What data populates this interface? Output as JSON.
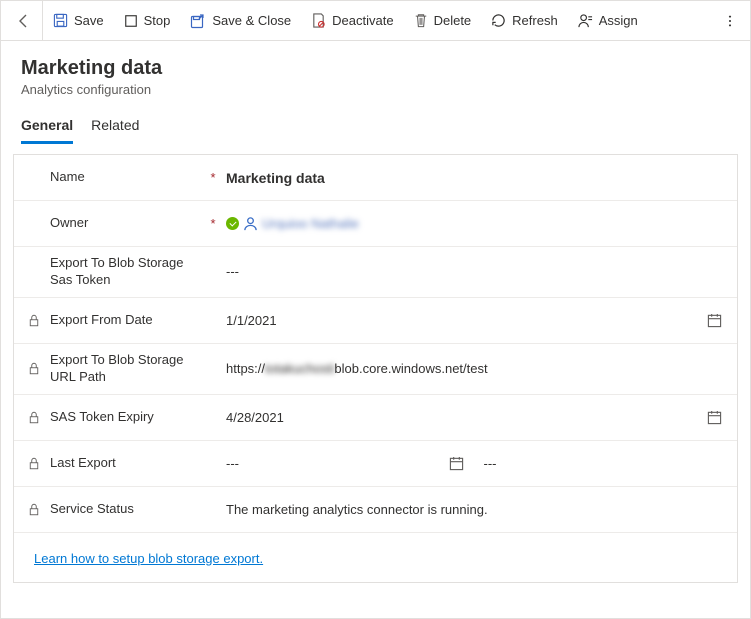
{
  "toolbar": {
    "save_label": "Save",
    "stop_label": "Stop",
    "save_close_label": "Save & Close",
    "deactivate_label": "Deactivate",
    "delete_label": "Delete",
    "refresh_label": "Refresh",
    "assign_label": "Assign"
  },
  "header": {
    "title": "Marketing data",
    "subtitle": "Analytics configuration"
  },
  "tabs": {
    "general": "General",
    "related": "Related"
  },
  "form": {
    "name_label": "Name",
    "name_value": "Marketing data",
    "owner_label": "Owner",
    "owner_value": "Urquioo Nathalie",
    "sas_token_label": "Export To Blob Storage Sas Token",
    "sas_token_value": "---",
    "from_date_label": "Export From Date",
    "from_date_value": "1/1/2021",
    "url_path_label": "Export To Blob Storage URL Path",
    "url_path_prefix": "https://",
    "url_path_hidden": "totakuchosti",
    "url_path_suffix": "blob.core.windows.net/test",
    "sas_expiry_label": "SAS Token Expiry",
    "sas_expiry_value": "4/28/2021",
    "last_export_label": "Last Export",
    "last_export_date_value": "---",
    "last_export_time_value": "---",
    "service_status_label": "Service Status",
    "service_status_value": "The marketing analytics connector is running."
  },
  "link": {
    "text": "Learn how to setup blob storage export."
  }
}
